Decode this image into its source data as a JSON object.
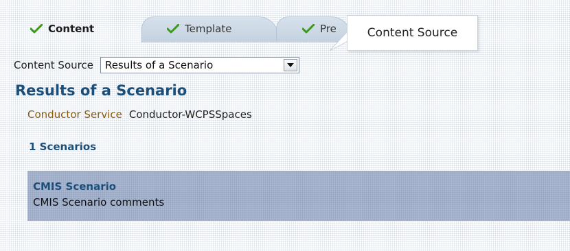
{
  "tabs": [
    {
      "label": "Content",
      "active": true,
      "icon": "check-icon"
    },
    {
      "label": "Template",
      "active": false,
      "icon": "check-icon"
    },
    {
      "label": "Pre",
      "active": false,
      "icon": "check-icon"
    }
  ],
  "tooltip": {
    "text": "Content Source"
  },
  "content_source": {
    "label": "Content Source",
    "selected": "Results of a Scenario"
  },
  "results": {
    "title": "Results of a Scenario",
    "service_label": "Conductor Service",
    "service_value": "Conductor-WCPSSpaces",
    "count": "1 Scenarios",
    "scenarios": [
      {
        "name": "CMIS Scenario",
        "comment": "CMIS Scenario comments"
      }
    ]
  },
  "colors": {
    "accent": "#1b4f7a",
    "service_label": "#8a5c12",
    "check": "#3c9a19",
    "panel": "#a9b6cf"
  }
}
